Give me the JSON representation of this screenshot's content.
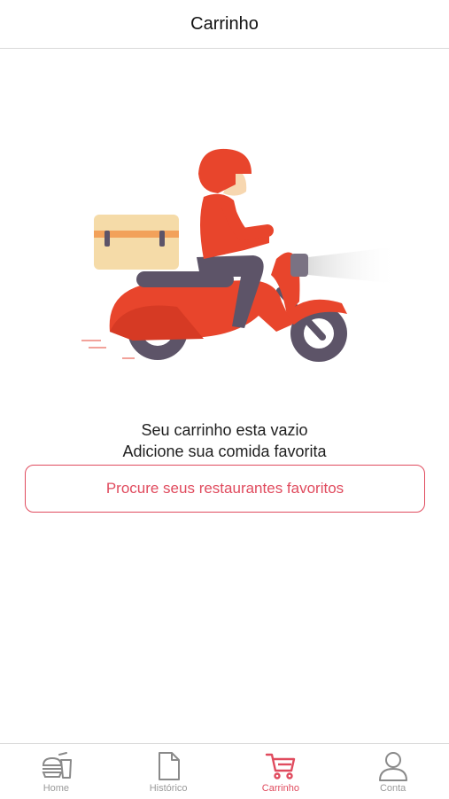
{
  "header": {
    "title": "Carrinho"
  },
  "empty_state": {
    "line1": "Seu carrinho esta vazio",
    "line2": "Adicione sua comida favorita",
    "cta_label": "Procure seus restaurantes favoritos"
  },
  "tabs": [
    {
      "label": "Home",
      "icon": "burger-drink-icon",
      "active": false
    },
    {
      "label": "Histórico",
      "icon": "document-icon",
      "active": false
    },
    {
      "label": "Carrinho",
      "icon": "cart-icon",
      "active": true
    },
    {
      "label": "Conta",
      "icon": "user-icon",
      "active": false
    }
  ],
  "colors": {
    "accent": "#e04b5e",
    "inactive": "#9a9a9a",
    "scooter": "#e8452c"
  }
}
